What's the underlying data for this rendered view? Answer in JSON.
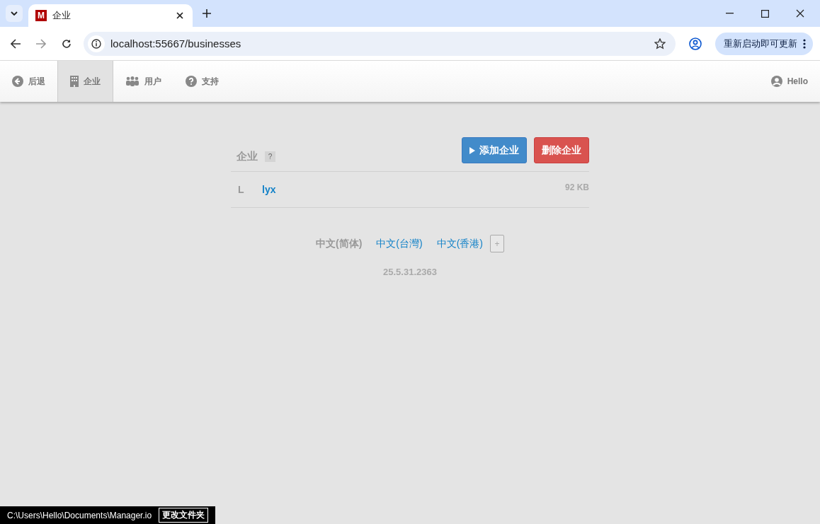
{
  "browser": {
    "tab": {
      "favicon": "M",
      "title": "企业"
    },
    "address": "localhost:55667/businesses",
    "update_button": "重新启动即可更新"
  },
  "nav": {
    "items": [
      {
        "label": "后退",
        "kind": "back",
        "selected": false
      },
      {
        "label": "企业",
        "kind": "building",
        "selected": true
      },
      {
        "label": "用户",
        "kind": "users",
        "selected": false
      },
      {
        "label": "支持",
        "kind": "help",
        "selected": false
      }
    ],
    "user": "Hello"
  },
  "businesses": {
    "title": "企业",
    "help": "?",
    "buttons": [
      {
        "label": "添加企业",
        "kind": "add"
      },
      {
        "label": "删除企业",
        "kind": "delete"
      }
    ],
    "rows": [
      {
        "initial": "L",
        "name": "lyx",
        "size": "92 KB"
      }
    ]
  },
  "languages": [
    {
      "label": "中文(简体)",
      "selected": true
    },
    {
      "label": "中文(台灣)",
      "selected": false
    },
    {
      "label": "中文(香港)",
      "selected": false
    }
  ],
  "add_language": "+",
  "version": "25.5.31.2363",
  "footer": {
    "path": "C:\\Users\\Hello\\Documents\\Manager.io",
    "button": "更改文件夹"
  }
}
